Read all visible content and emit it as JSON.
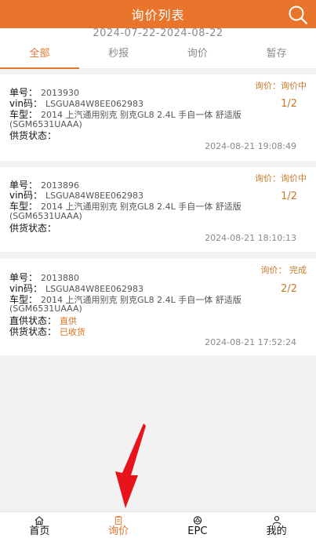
{
  "header": {
    "title": "询价列表"
  },
  "date_range": "2024-07-22-2024-08-22",
  "tabs": [
    {
      "label": "全部",
      "active": true
    },
    {
      "label": "秒报",
      "active": false
    },
    {
      "label": "询价",
      "active": false
    },
    {
      "label": "暂存",
      "active": false
    }
  ],
  "cards": [
    {
      "status": "询价：询价中",
      "ratio": "1/2",
      "order_label": "单号：",
      "order_no": "2013930",
      "vin_label": "vin码：",
      "vin": "LSGUA84W8EE062983",
      "model_label": "车型：",
      "model_line1": "2014 上汽通用别克 别克GL8 2.4L 手自一体 舒适版",
      "model_line2": "(SGM6531UAAA)",
      "supply_label": "供货状态：",
      "supply_value": "",
      "time": "2024-08-21 19:08:49"
    },
    {
      "status": "询价：询价中",
      "ratio": "1/2",
      "order_label": "单号：",
      "order_no": "2013896",
      "vin_label": "vin码：",
      "vin": "LSGUA84W8EE062983",
      "model_label": "车型：",
      "model_line1": "2014 上汽通用别克 别克GL8 2.4L 手自一体 舒适版",
      "model_line2": "(SGM6531UAAA)",
      "supply_label": "供货状态：",
      "supply_value": "",
      "time": "2024-08-21 18:10:13"
    },
    {
      "status": "询价：  完成",
      "ratio": "2/2",
      "order_label": "单号：",
      "order_no": "2013880",
      "vin_label": "vin码：",
      "vin": "LSGUA84W8EE062983",
      "model_label": "车型：",
      "model_line1": "2014 上汽通用别克 别克GL8 2.4L 手自一体 舒适版",
      "model_line2": "(SGM6531UAAA)",
      "direct_label": "直供状态：",
      "direct_value": "直供",
      "supply_label": "供货状态：",
      "supply_value": "已收货",
      "time": "2024-08-21 17:52:24"
    }
  ],
  "bottom_nav": [
    {
      "label": "首页",
      "icon": "home-icon",
      "active": false
    },
    {
      "label": "询价",
      "icon": "inquiry-icon",
      "active": true
    },
    {
      "label": "EPC",
      "icon": "epc-icon",
      "active": false
    },
    {
      "label": "我的",
      "icon": "user-icon",
      "active": false
    }
  ],
  "colors": {
    "accent": "#e9742b",
    "status": "#c77a2a",
    "annotation_arrow": "#e8141b"
  }
}
